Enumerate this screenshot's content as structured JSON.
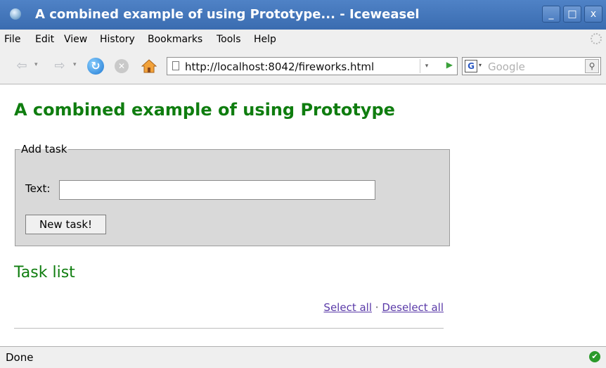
{
  "window": {
    "title": "A combined example of using Prototype... - Iceweasel",
    "minimize": "_",
    "maximize": "□",
    "close": "x"
  },
  "menu": [
    "File",
    "Edit",
    "View",
    "History",
    "Bookmarks",
    "Tools",
    "Help"
  ],
  "nav": {
    "back": "⇦",
    "forward": "⇨",
    "dropdown": "▾",
    "reload": "↻",
    "stop": "✕",
    "url": "http://localhost:8042/fireworks.html",
    "go": "▶",
    "search_engine": "G",
    "search_placeholder": "Google",
    "search_button": "⚲"
  },
  "page": {
    "heading": "A combined example of using Prototype",
    "fieldset_legend": "Add task",
    "text_label": "Text:",
    "text_value": "",
    "new_task_button": "New task!",
    "task_list_heading": "Task list",
    "select_all": "Select all",
    "separator": "·",
    "deselect_all": "Deselect all"
  },
  "status": {
    "text": "Done",
    "icon": "check-icon"
  },
  "colors": {
    "title_bar": "#3f72b8",
    "heading": "#0f7d0f",
    "link": "#5a3aa8",
    "fieldset_bg": "#d9d9d9"
  }
}
